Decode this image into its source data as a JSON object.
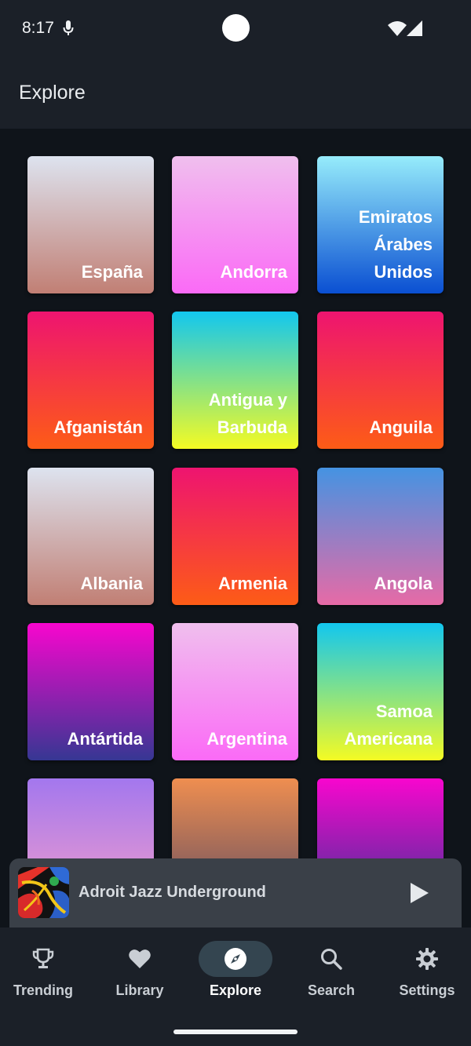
{
  "status_bar": {
    "time": "8:17",
    "icons": [
      "mic-icon",
      "wifi-icon",
      "signal-icon"
    ]
  },
  "app_bar": {
    "title": "Explore"
  },
  "tiles": [
    {
      "label": "España",
      "gradient": [
        "#dde3ef",
        "#c17f74"
      ]
    },
    {
      "label": "Andorra",
      "gradient": [
        "#f0bfee",
        "#fb6af6"
      ]
    },
    {
      "label": "Emiratos\nÁrabes\nUnidos",
      "gradient": [
        "#96ecfb",
        "#0a4fd2"
      ]
    },
    {
      "label": "Afganistán",
      "gradient": [
        "#ee1470",
        "#fd5c16"
      ]
    },
    {
      "label": "Antigua y\nBarbuda",
      "gradient": [
        "#12c7ef",
        "#f4fb23"
      ]
    },
    {
      "label": "Anguila",
      "gradient": [
        "#ee1470",
        "#fd5c16"
      ]
    },
    {
      "label": "Albania",
      "gradient": [
        "#dde3ef",
        "#c17f74"
      ]
    },
    {
      "label": "Armenia",
      "gradient": [
        "#ee1470",
        "#fd5c16"
      ]
    },
    {
      "label": "Angola",
      "gradient": [
        "#4593e2",
        "#e76aa6"
      ]
    },
    {
      "label": "Antártida",
      "gradient": [
        "#f806ce",
        "#363793"
      ]
    },
    {
      "label": "Argentina",
      "gradient": [
        "#f0bfee",
        "#fb6af6"
      ]
    },
    {
      "label": "Samoa\nAmericana",
      "gradient": [
        "#12c7ef",
        "#f4fb23"
      ]
    },
    {
      "label": "",
      "gradient": [
        "#a377ee",
        "#f5a0ca"
      ]
    },
    {
      "label": "",
      "gradient": [
        "#ef8e50",
        "#5c4a62"
      ]
    },
    {
      "label": "",
      "gradient": [
        "#f806ce",
        "#363793"
      ]
    }
  ],
  "mini_player": {
    "track_title": "Adroit Jazz Underground",
    "play_icon": "play-icon"
  },
  "bottom_nav": {
    "items": [
      {
        "label": "Trending",
        "icon": "trophy-icon",
        "active": false
      },
      {
        "label": "Library",
        "icon": "heart-icon",
        "active": false
      },
      {
        "label": "Explore",
        "icon": "compass-icon",
        "active": true
      },
      {
        "label": "Search",
        "icon": "search-icon",
        "active": false
      },
      {
        "label": "Settings",
        "icon": "gear-icon",
        "active": false
      }
    ]
  },
  "colors": {
    "surface": "#1b2028",
    "background": "#0f141a",
    "player": "#3a4048",
    "active_pill": "#344550"
  }
}
